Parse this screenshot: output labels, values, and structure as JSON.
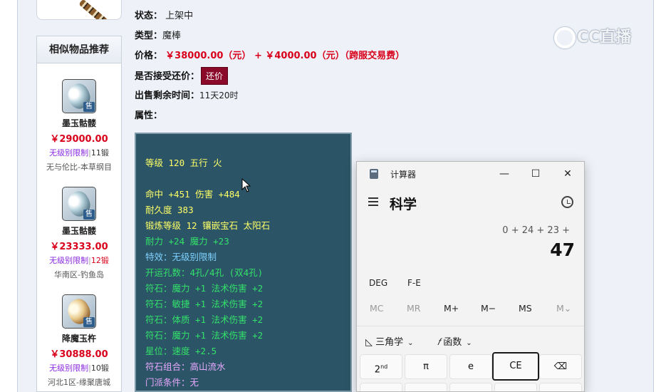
{
  "details": {
    "status_label": "状态：",
    "status_value": "上架中",
    "type_label": "类型：",
    "type_value": "魔棒",
    "price_label": "价格：",
    "price_value": "￥38000.00（元） + ￥4000.00（元）（跨服交易费）",
    "bargain_label": "是否接受还价：",
    "bargain_button": "还价",
    "remaining_label": "出售剩余时间：",
    "remaining_value": "11天20时",
    "attributes_label": "属性："
  },
  "watermark": "CC直播",
  "recommendations": {
    "title": "相似物品推荐",
    "items": [
      {
        "name": "墨玉骷髅",
        "price": "￥29000.00",
        "level": "无级别限制",
        "sep": "|",
        "forge": "11锻",
        "server": "无与伦比-本草纲目",
        "icon": "staff-jade-icon"
      },
      {
        "name": "墨玉骷髅",
        "price": "￥23333.00",
        "level": "无级别限制",
        "sep": "|",
        "forge": "12锻",
        "server": "华南区-钓鱼岛",
        "icon": "staff-jade-icon"
      },
      {
        "name": "降魔玉杵",
        "price": "￥30888.00",
        "level": "无级别限制",
        "sep": "|",
        "forge": "10锻",
        "server": "河北1区-缘聚唐城",
        "icon": "staff-gold-icon"
      }
    ],
    "sale_badge": "售"
  },
  "attributes": [
    {
      "text": "等级 120 五行 火",
      "color": "yellow"
    },
    {
      "text": "",
      "color": "yellow"
    },
    {
      "text": "命中 +451 伤害 +484",
      "color": "yellow"
    },
    {
      "text": "耐久度 383",
      "color": "yellow"
    },
    {
      "text": "锻炼等级 12 镶嵌宝石 太阳石",
      "color": "yellow"
    },
    {
      "text": "耐力 +24 魔力 +23",
      "color": "green"
    },
    {
      "text": "特效：无级别限制",
      "color": "blue"
    },
    {
      "text": "开运孔数：4孔/4孔 (双4孔)",
      "color": "green"
    },
    {
      "text": "符石：魔力 +1 法术伤害 +2",
      "color": "green"
    },
    {
      "text": "符石：敏捷 +1 法术伤害 +2",
      "color": "green"
    },
    {
      "text": "符石：体质 +1 法术伤害 +2",
      "color": "green"
    },
    {
      "text": "符石：魔力 +1 法术伤害 +2",
      "color": "green"
    },
    {
      "text": "星位：速度 +2.5",
      "color": "green"
    },
    {
      "text": "符石组合：高山流水",
      "color": "violet"
    },
    {
      "text": "门派条件：无",
      "color": "violet"
    }
  ],
  "calculator": {
    "title": "计算器",
    "mode": "科学",
    "expression": "0 + 24 + 23 +",
    "result": "47",
    "angle_mode": "DEG",
    "fe_label": "F-E",
    "memory": [
      "MC",
      "MR",
      "M+",
      "M−",
      "MS",
      "M⌄"
    ],
    "trig_label": "三角学",
    "func_label": "函数",
    "keys": [
      "2nd",
      "π",
      "e",
      "CE",
      "⌫"
    ]
  }
}
